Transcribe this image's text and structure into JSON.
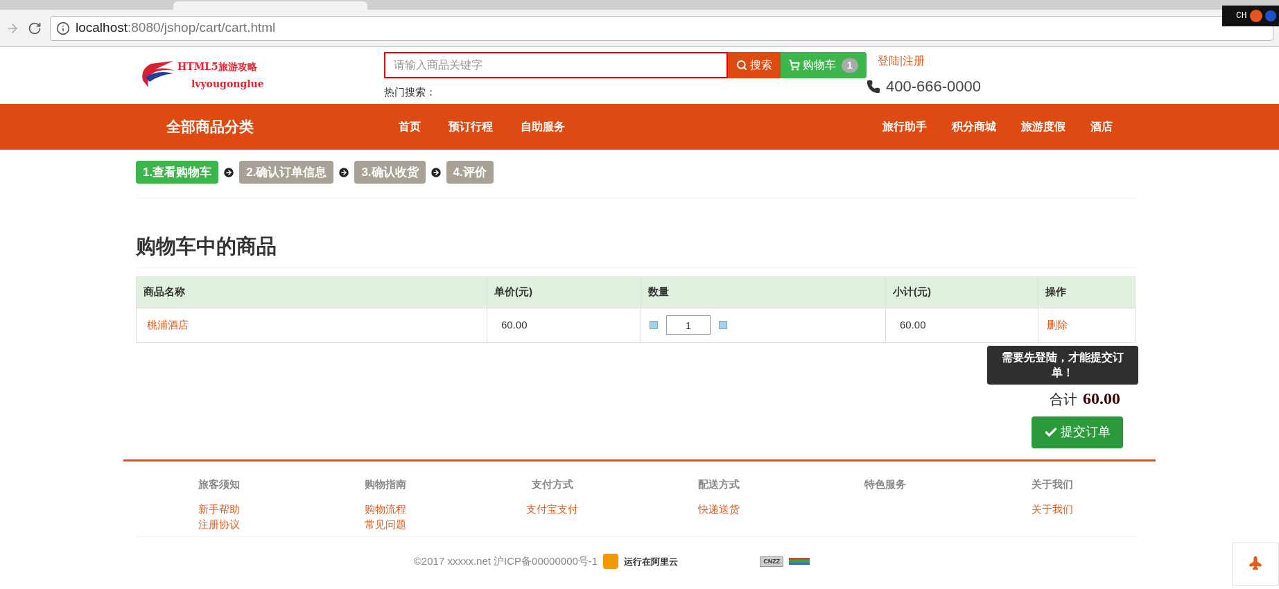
{
  "browser": {
    "url_host": "localhost",
    "url_path": ":8080/jshop/cart/cart.html"
  },
  "ime_toolbar": {
    "label": "CH"
  },
  "header": {
    "logo_title": "HTML5旅游攻略",
    "logo_subtitle": "lvyougonglue",
    "search_placeholder": "请输入商品关键字",
    "search_button": "搜索",
    "cart_button": "购物车",
    "cart_count": "1",
    "hot_search": "热门搜索：",
    "login": "登陆",
    "separator": "|",
    "register": "注册",
    "phone": "400-666-0000"
  },
  "nav": {
    "category": "全部商品分类",
    "left_links": [
      "首页",
      "预订行程",
      "自助服务"
    ],
    "right_links": [
      "旅行助手",
      "积分商城",
      "旅游度假",
      "酒店"
    ]
  },
  "steps": [
    {
      "label": "1.查看购物车",
      "selected": true
    },
    {
      "label": "2.确认订单信息",
      "selected": false
    },
    {
      "label": "3.确认收货",
      "selected": false
    },
    {
      "label": "4.评价",
      "selected": false
    }
  ],
  "heading": "购物车中的商品",
  "table": {
    "columns": [
      "商品名称",
      "单价(元)",
      "数量",
      "小计(元)",
      "操作"
    ],
    "rows": [
      {
        "name": "桃浦酒店",
        "price": "60.00",
        "quantity": "1",
        "subtotal": "60.00",
        "action": "删除"
      }
    ]
  },
  "total": {
    "label": "合计",
    "value": "60.00"
  },
  "tooltip": "需要先登陆，才能提交订单！",
  "submit_button": "提交订单",
  "footer": {
    "columns": [
      {
        "title": "旅客须知",
        "links": [
          "新手帮助",
          "注册协议"
        ]
      },
      {
        "title": "购物指南",
        "links": [
          "购物流程",
          "常见问题"
        ]
      },
      {
        "title": "支付方式",
        "links": [
          "支付宝支付"
        ]
      },
      {
        "title": "配送方式",
        "links": [
          "快递送货"
        ]
      },
      {
        "title": "特色服务"
      },
      {
        "title": "关于我们",
        "links": [
          "关于我们"
        ]
      }
    ],
    "copyright": "©2017 xxxxx.net 沪ICP备00000000号-1",
    "aliyun": "运行在阿里云",
    "cnzz": "CNZZ"
  }
}
